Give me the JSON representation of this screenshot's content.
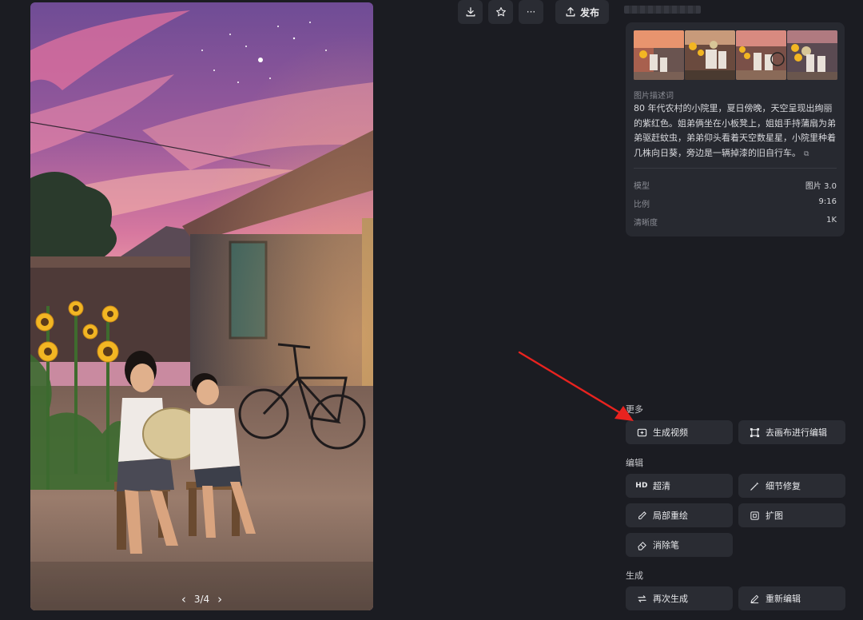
{
  "toolbar": {
    "download_icon": "download-icon",
    "favorite_icon": "star-icon",
    "more_label": "···",
    "publish_label": "发布"
  },
  "image": {
    "pager": "3/4",
    "prev_icon": "chevron-left-icon",
    "next_icon": "chevron-right-icon"
  },
  "info": {
    "desc_label": "图片描述词",
    "description": "80 年代农村的小院里，夏日傍晚，天空呈现出绚丽的紫红色。姐弟俩坐在小板凳上，姐姐手持蒲扇为弟弟驱赶蚊虫，弟弟仰头看着天空数星星，小院里种着几株向日葵，旁边是一辆掉漆的旧自行车。",
    "meta": [
      {
        "key": "模型",
        "value": "图片 3.0"
      },
      {
        "key": "比例",
        "value": "9:16"
      },
      {
        "key": "清晰度",
        "value": "1K"
      }
    ]
  },
  "sections": {
    "more": {
      "title": "更多",
      "buttons": [
        "生成视频",
        "去画布进行编辑"
      ]
    },
    "edit": {
      "title": "编辑",
      "hd_prefix": "HD",
      "buttons": [
        "超清",
        "细节修复",
        "局部重绘",
        "扩图",
        "消除笔"
      ]
    },
    "generate": {
      "title": "生成",
      "buttons": [
        "再次生成",
        "重新编辑"
      ]
    }
  },
  "colors": {
    "background": "#1b1c22",
    "card": "#272930",
    "button": "#2a2c33",
    "annotation_arrow": "#e8231f"
  }
}
